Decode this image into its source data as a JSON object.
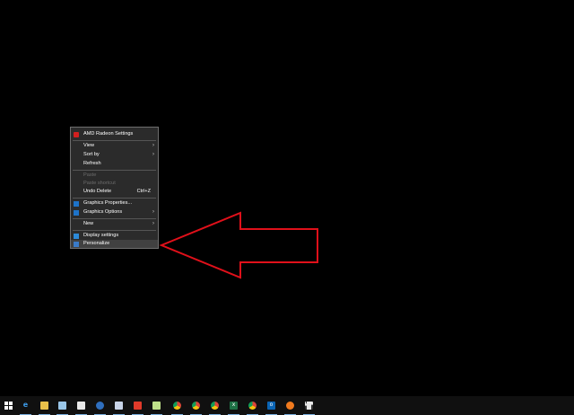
{
  "context_menu": {
    "items": [
      {
        "label": "AMD Radeon Settings"
      },
      {
        "label": "View"
      },
      {
        "label": "Sort by"
      },
      {
        "label": "Refresh"
      },
      {
        "label": "Paste"
      },
      {
        "label": "Paste shortcut"
      },
      {
        "label": "Undo Delete",
        "shortcut": "Ctrl+Z"
      },
      {
        "label": "Graphics Properties..."
      },
      {
        "label": "Graphics Options"
      },
      {
        "label": "New"
      },
      {
        "label": "Display settings"
      },
      {
        "label": "Personalize"
      }
    ]
  },
  "annotation": {
    "color": "#e0101a"
  },
  "taskbar": {
    "start_icon": "windows-logo-icon",
    "edge_glyph": "e",
    "outlook_glyph": "o",
    "excel_glyph": "x"
  }
}
